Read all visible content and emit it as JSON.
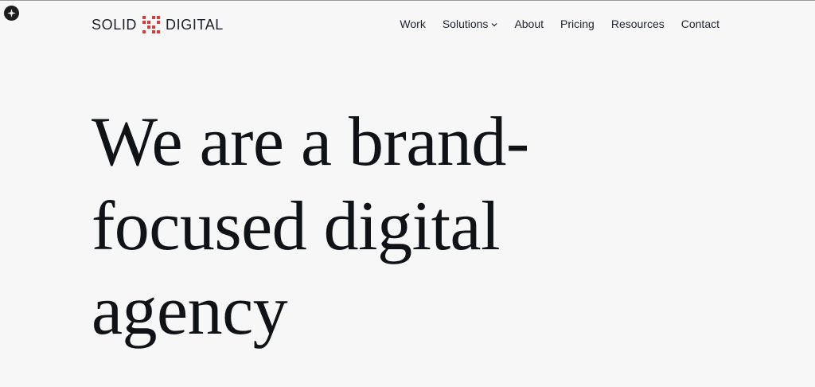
{
  "badge": {
    "icon": "sparkle-icon"
  },
  "logo": {
    "word_left": "SOLID",
    "word_right": "DIGITAL",
    "mark_icon": "dot-grid-logo-icon",
    "mark_color": "#d63b3b"
  },
  "nav": {
    "items": [
      {
        "label": "Work"
      },
      {
        "label": "Solutions",
        "icon": "chevron-down-icon"
      },
      {
        "label": "About"
      },
      {
        "label": "Pricing"
      },
      {
        "label": "Resources"
      },
      {
        "label": "Contact"
      }
    ]
  },
  "hero": {
    "lines": [
      "We are a brand-",
      "focused digital",
      "agency"
    ]
  },
  "colors": {
    "background": "#f7f7f7",
    "text": "#111418",
    "accent": "#d63b3b"
  }
}
